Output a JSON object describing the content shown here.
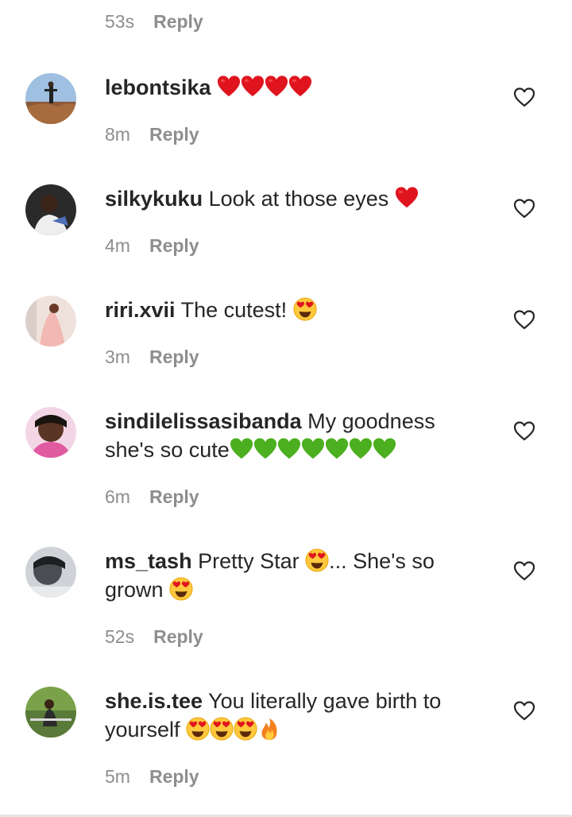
{
  "top": {
    "time": "53s",
    "reply": "Reply"
  },
  "comments": [
    {
      "username": "lebontsika",
      "text": "",
      "emojis": [
        "red-heart",
        "red-heart",
        "red-heart",
        "red-heart"
      ],
      "time": "8m",
      "reply": "Reply"
    },
    {
      "username": "silkykuku",
      "text": "Look at those eyes",
      "emojis": [
        "red-heart"
      ],
      "time": "4m",
      "reply": "Reply"
    },
    {
      "username": "riri.xvii",
      "text": "The cutest!",
      "emojis": [
        "heart-eyes"
      ],
      "time": "3m",
      "reply": "Reply"
    },
    {
      "username": "sindilelissasibanda",
      "text_line1": "My goodness",
      "text_line2": "she's so cute",
      "emojis": [
        "green-heart",
        "green-heart",
        "green-heart",
        "green-heart",
        "green-heart",
        "green-heart",
        "green-heart"
      ],
      "time": "6m",
      "reply": "Reply"
    },
    {
      "username": "ms_tash",
      "text_a": "Pretty Star",
      "text_b": "... She's so",
      "text_c": "grown",
      "emojis": [
        "heart-eyes",
        "heart-eyes"
      ],
      "time": "52s",
      "reply": "Reply"
    },
    {
      "username": "she.is.tee",
      "text_line1": "You literally gave birth to",
      "text_line2": "yourself",
      "emojis": [
        "heart-eyes",
        "heart-eyes",
        "heart-eyes",
        "fire"
      ],
      "time": "5m",
      "reply": "Reply"
    }
  ],
  "colors": {
    "text": "#262626",
    "meta": "#8e8e8e",
    "red_heart": "#e0141e",
    "green_heart": "#4caf1f",
    "emoji_face": "#ffc83d"
  },
  "icons": {
    "like": "heart-outline-icon"
  }
}
